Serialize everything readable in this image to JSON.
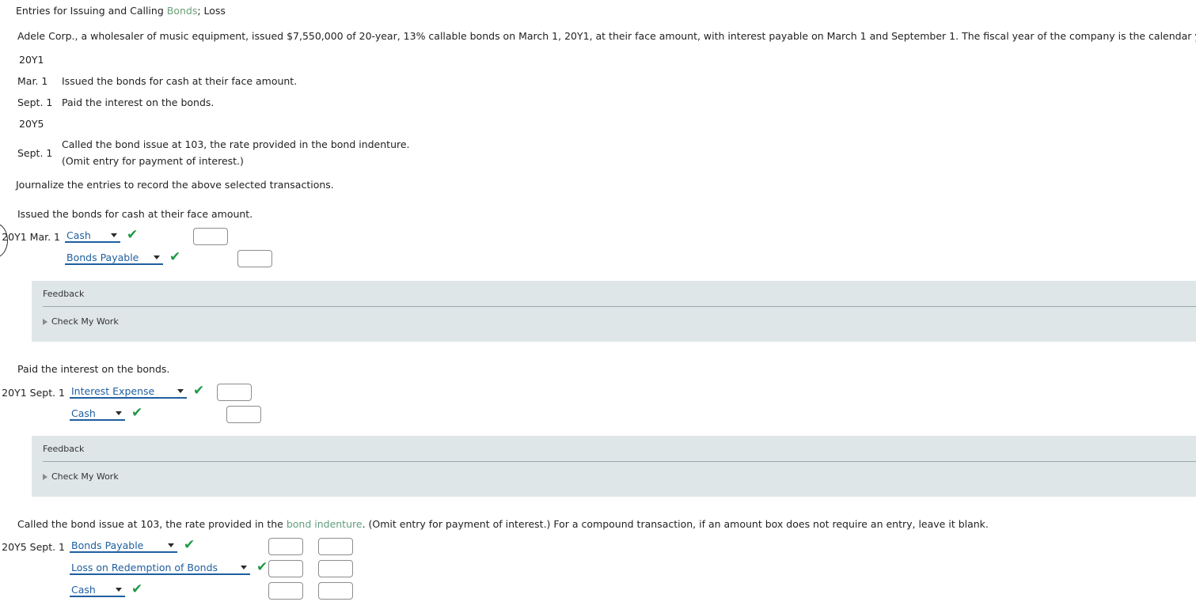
{
  "title": {
    "before": "Entries for Issuing and Calling ",
    "link": "Bonds",
    "after": "; Loss"
  },
  "problem": {
    "text": "Adele Corp., a wholesaler of music equipment, issued $7,550,000 of 20-year, 13% callable bonds on March 1, 20Y1, at their face amount, with interest payable on March 1 and September 1. The fiscal year of the company is the calendar year."
  },
  "timeline": {
    "year1_label": "20Y1",
    "year5_label": "20Y5",
    "event1_date": "Mar. 1",
    "event1_text": "Issued the bonds for cash at their face amount.",
    "event2_date": "Sept. 1",
    "event2_text": "Paid the interest on the bonds.",
    "event3_date": "Sept. 1",
    "event3_line1": "Called the bond issue at 103, the rate provided in the bond indenture.",
    "event3_line2": "(Omit entry for payment of interest.)"
  },
  "instruction": "Journalize the entries to record the above selected transactions.",
  "entries": [
    {
      "prompt": "Issued the bonds for cash at their face amount.",
      "rows": [
        {
          "date": "20Y1 Mar. 1",
          "account": "Cash",
          "check": "✔",
          "debit": "",
          "credit": null
        },
        {
          "date": "",
          "account": "Bonds Payable",
          "check": "✔",
          "debit": null,
          "credit": ""
        }
      ]
    },
    {
      "prompt": "Paid the interest on the bonds.",
      "rows": [
        {
          "date": "20Y1 Sept. 1",
          "account": "Interest Expense",
          "check": "✔",
          "debit": "",
          "credit": null
        },
        {
          "date": "",
          "account": "Cash",
          "check": "✔",
          "debit": null,
          "credit": ""
        }
      ]
    },
    {
      "prompt_before": "Called the bond issue at 103, the rate provided in the ",
      "prompt_link": "bond indenture",
      "prompt_after": ". (Omit entry for payment of interest.) For a compound transaction, if an amount box does not require an entry, leave it blank.",
      "rows": [
        {
          "date": "20Y5 Sept. 1",
          "account": "Bonds Payable",
          "check": "✔",
          "debit": "",
          "credit": ""
        },
        {
          "date": "",
          "account": "Loss on Redemption of Bonds",
          "check": "✔",
          "debit": "",
          "credit": ""
        },
        {
          "date": "",
          "account": "Cash",
          "check": "✔",
          "debit": "",
          "credit": ""
        }
      ]
    }
  ],
  "feedback": {
    "title": "Feedback",
    "check_my_work": "Check My Work"
  },
  "colors": {
    "link_green": "#6b9e78",
    "select_blue": "#1f5fa0",
    "check_green": "#1f9a46",
    "feedback_bg": "#dfe6e8"
  }
}
